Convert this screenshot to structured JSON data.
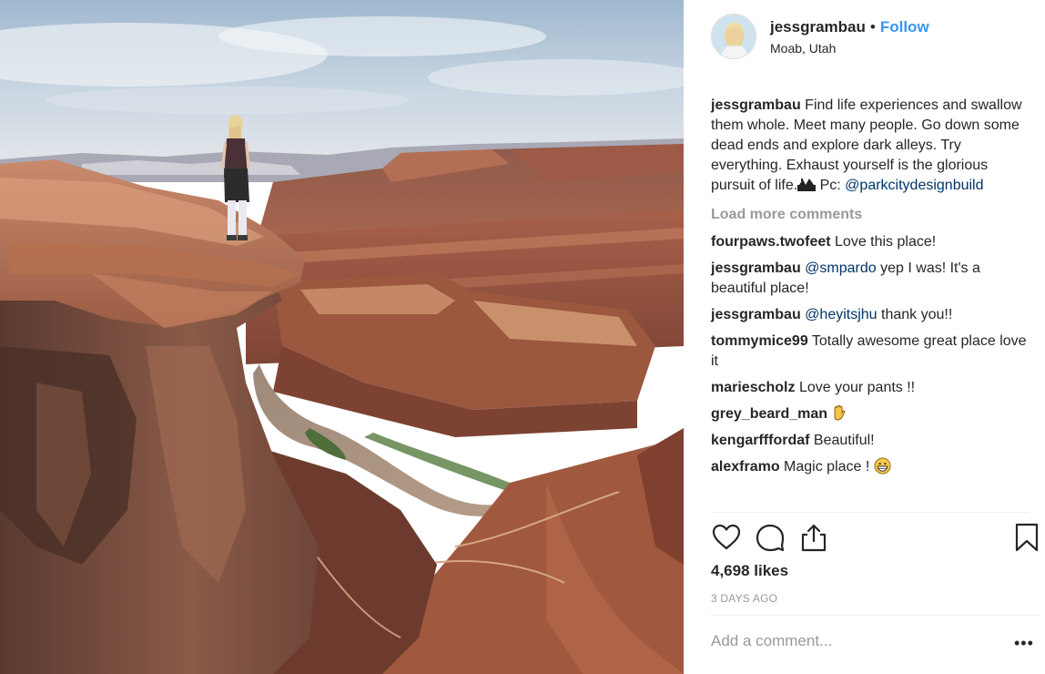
{
  "post": {
    "username": "jessgrambau",
    "separator": "•",
    "follow_label": "Follow",
    "location": "Moab, Utah",
    "caption": {
      "author": "jessgrambau",
      "text": "Find life experiences and swallow them whole. Meet many people. Go down some dead ends and explore dark alleys. Try everything. Exhaust yourself is the glorious pursuit of life.",
      "emoji_icon": "national-park-icon",
      "suffix": " Pc: ",
      "mention": "@parkcitydesignbuild"
    },
    "load_more_label": "Load more comments",
    "comments": [
      {
        "author": "fourpaws.twofeet",
        "mention": "",
        "text": "Love this place!"
      },
      {
        "author": "jessgrambau",
        "mention": "@smpardo",
        "text": "yep I was! It's a beautiful place!"
      },
      {
        "author": "jessgrambau",
        "mention": "@heyitsjhu",
        "text": "thank you!!"
      },
      {
        "author": "tommymice99",
        "mention": "",
        "text": "Totally awesome great place love it"
      },
      {
        "author": "mariescholz",
        "mention": "",
        "text": "Love your pants !!"
      },
      {
        "author": "grey_beard_man",
        "mention": "",
        "text": "",
        "emoji_icon": "raised-hand-icon"
      },
      {
        "author": "kengarfffordaf",
        "mention": "",
        "text": "Beautiful!"
      },
      {
        "author": "alexframo",
        "mention": "",
        "text": "Magic place !",
        "emoji_icon": "grinning-face-icon"
      }
    ],
    "likes_label": "4,698 likes",
    "time_ago": "3 DAYS AGO",
    "comment_placeholder": "Add a comment...",
    "more_label": "•••",
    "icons": [
      "heart-icon",
      "comment-icon",
      "share-icon",
      "bookmark-icon"
    ],
    "colors": {
      "link": "#3897f0",
      "mention": "#003569",
      "muted": "#999999",
      "text": "#262626"
    }
  }
}
